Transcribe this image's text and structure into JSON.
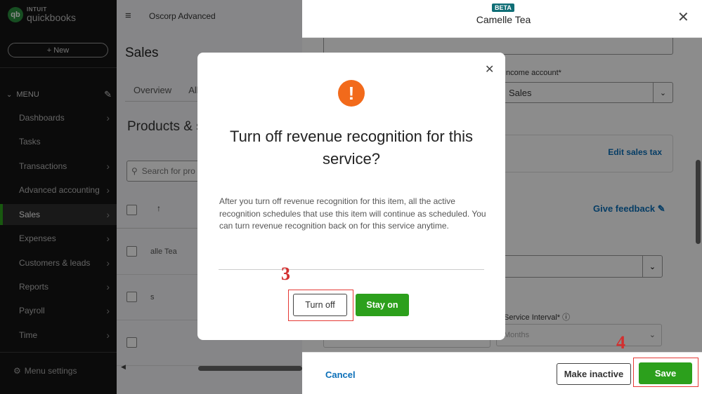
{
  "sidebar": {
    "logo_brand": "INTUIT",
    "logo_product": "quickbooks",
    "logo_mark": "qb",
    "new_button": "+ New",
    "menu_label": "MENU",
    "items": [
      {
        "label": "Dashboards"
      },
      {
        "label": "Tasks"
      },
      {
        "label": "Transactions"
      },
      {
        "label": "Advanced accounting"
      },
      {
        "label": "Sales"
      },
      {
        "label": "Expenses"
      },
      {
        "label": "Customers & leads"
      },
      {
        "label": "Reports"
      },
      {
        "label": "Payroll"
      },
      {
        "label": "Time"
      }
    ],
    "menu_settings": "Menu settings"
  },
  "main": {
    "company": "Oscorp Advanced",
    "page_title": "Sales",
    "tabs": [
      "Overview",
      "All"
    ],
    "section_title": "Products & s",
    "search_placeholder": "Search for pro",
    "rows": [
      "alle Tea",
      "s",
      ""
    ]
  },
  "drawer": {
    "beta": "BETA",
    "title": "Camelle Tea",
    "income_label": "Income account*",
    "income_value": "Sales",
    "edit_sales_tax": "Edit sales tax",
    "give_feedback": "Give feedback",
    "service_interval_label": "Service Interval*",
    "service_interval_value": "Months",
    "cancel": "Cancel",
    "make_inactive": "Make inactive",
    "save": "Save"
  },
  "modal": {
    "title": "Turn off revenue recognition for this service?",
    "body": "After you turn off revenue recognition for this item, all the active recognition schedules that use this item will continue as scheduled. You can turn revenue recognition back on for this service anytime.",
    "turn_off": "Turn off",
    "stay_on": "Stay on"
  },
  "annotations": {
    "step3": "3",
    "step4": "4"
  },
  "colors": {
    "brand_green": "#2ca01c",
    "link_blue": "#0b6fb8",
    "warning_orange": "#f26a1b",
    "annotation_red": "#d32f2f"
  }
}
